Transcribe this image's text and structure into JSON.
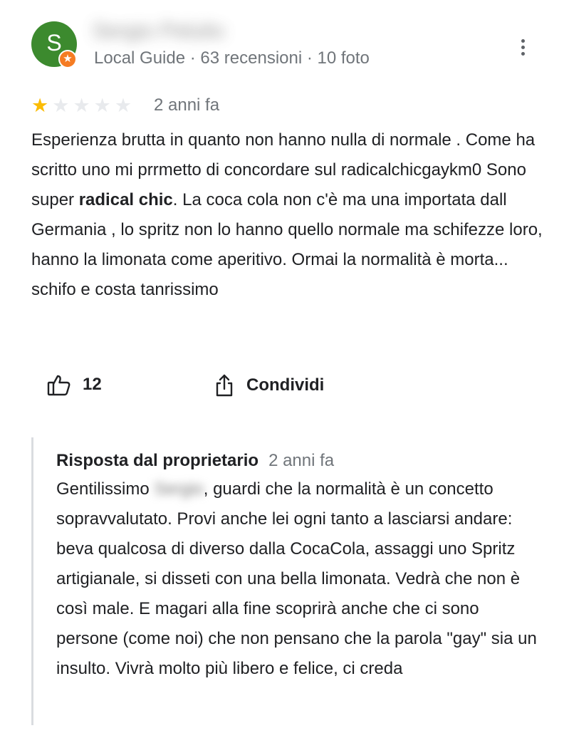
{
  "reviewer": {
    "avatar_letter": "S",
    "name": "Sergio Pelulio",
    "meta": "Local Guide · 63 recensioni · 10 foto"
  },
  "icons": {
    "more": "more-vert-icon",
    "guide_badge": "local-guide-star-icon",
    "like": "thumb-up-icon",
    "share": "share-icon"
  },
  "rating": {
    "value": 1,
    "max": 5
  },
  "review": {
    "date": "2 anni fa",
    "text_before_bold": "Esperienza brutta  in quanto non hanno nulla di normale . Come ha scritto uno mi prrmetto di concordare sul radicalchicgaykm0 Sono super ",
    "text_bold": "radical chic",
    "text_after_bold": ". La coca cola non c'è ma una importata dall Germania , lo spritz non lo hanno quello normale ma schifezze loro,  hanno la limonata come aperitivo. Ormai la normalità è morta... schifo e costa tanrissimo"
  },
  "actions": {
    "like_count": "12",
    "share_label": "Condividi"
  },
  "owner_reply": {
    "title": "Risposta dal proprietario",
    "date": "2 anni fa",
    "greeting": "Gentilissimo ",
    "blurred_name": "Sergio",
    "text": ", guardi che la normalità è un concetto sopravvalutato. Provi anche lei ogni tanto a lasciarsi andare: beva qualcosa di diverso dalla CocaCola, assaggi uno Spritz artigianale, si disseti con una bella limonata. Vedrà che non è così male. E magari alla fine scoprirà anche che ci sono persone (come noi) che non pensano che la parola \"gay\" sia un insulto. Vivrà molto più libero e felice, ci creda"
  },
  "colors": {
    "avatar_bg": "#3c8a2e",
    "badge_bg": "#f57c23",
    "star_on": "#fbbc04",
    "star_off": "#e8eaed",
    "secondary_text": "#70757a",
    "reply_border": "#dadce0"
  }
}
